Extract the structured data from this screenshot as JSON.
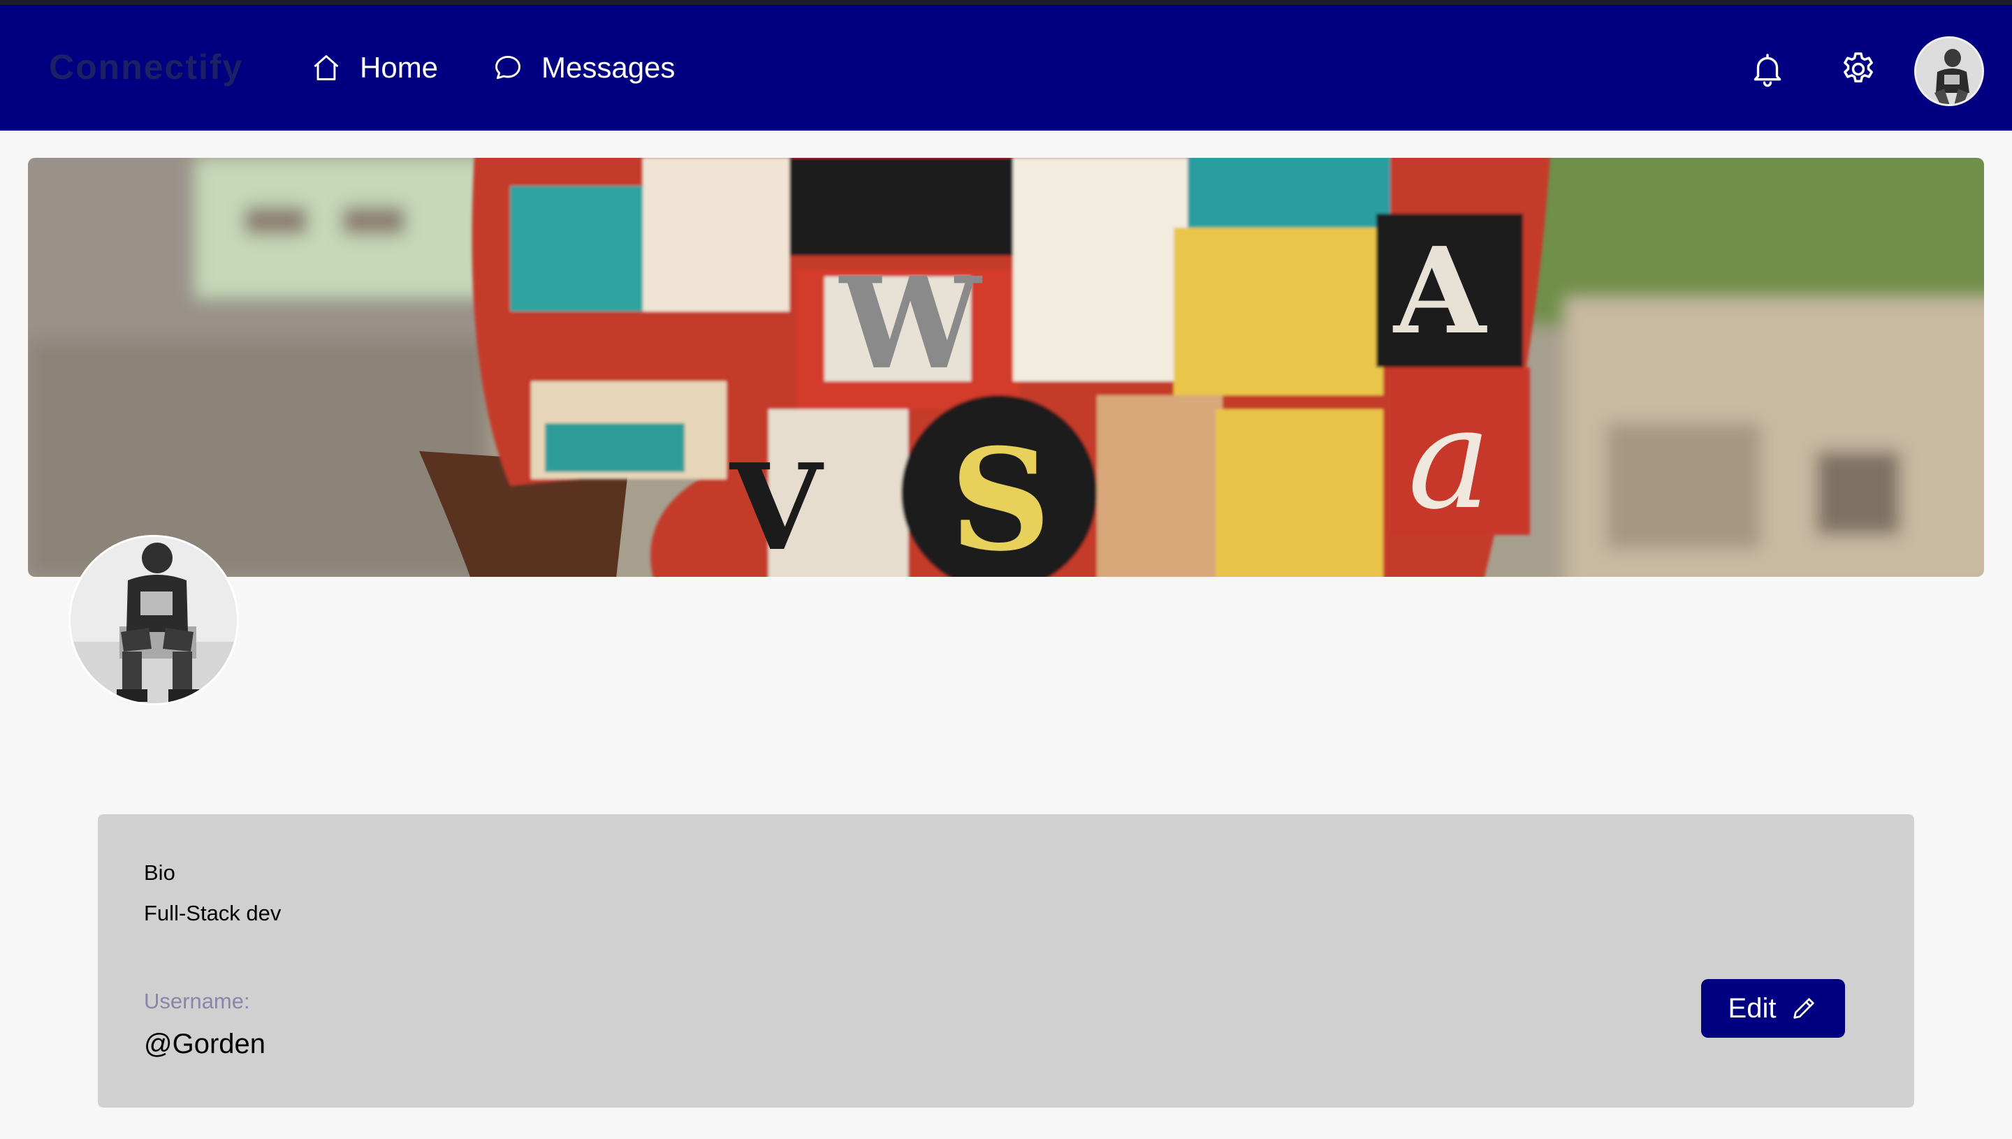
{
  "app": {
    "brand": "Connectify"
  },
  "nav": {
    "home_label": "Home",
    "messages_label": "Messages"
  },
  "icons": {
    "home": "home-icon",
    "messages": "chat-bubble-icon",
    "notifications": "bell-icon",
    "settings": "gear-icon",
    "edit": "pencil-icon"
  },
  "profile": {
    "bio_label": "Bio",
    "bio": "Full-Stack dev",
    "username_label": "Username:",
    "username": "@Gorden",
    "edit_label": "Edit"
  },
  "colors": {
    "navbar": "#000080",
    "brand_text": "#1c2166",
    "card": "#d0d0d0",
    "button": "#000080",
    "muted_label": "#8a86ab"
  }
}
